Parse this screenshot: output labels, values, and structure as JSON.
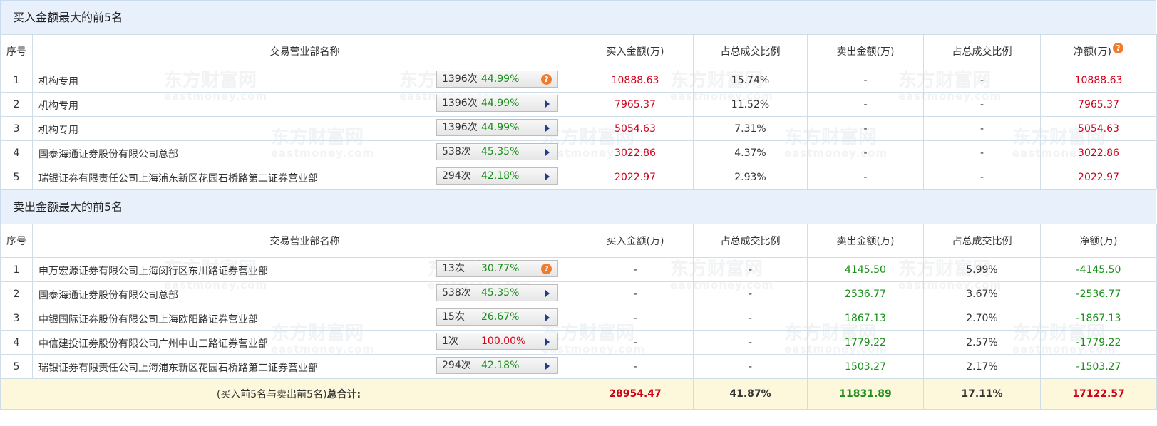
{
  "watermark": {
    "cn": "东方财富网",
    "en": "eastmoney.com"
  },
  "headers": {
    "no": "序号",
    "name": "交易营业部名称",
    "buy": "买入金额(万)",
    "buy_ratio": "占总成交比例",
    "sell": "卖出金额(万)",
    "sell_ratio": "占总成交比例",
    "net": "净额(万)"
  },
  "help_glyph": "?",
  "buy_section": {
    "title": "买入金额最大的前5名",
    "rows": [
      {
        "no": "1",
        "name": "机构专用",
        "count": "1396次",
        "pct": "44.99%",
        "pct_color": "green",
        "action": "help",
        "buy": "10888.63",
        "buy_ratio": "15.74%",
        "sell": "-",
        "sell_ratio": "-",
        "net": "10888.63"
      },
      {
        "no": "2",
        "name": "机构专用",
        "count": "1396次",
        "pct": "44.99%",
        "pct_color": "green",
        "action": "arrow",
        "buy": "7965.37",
        "buy_ratio": "11.52%",
        "sell": "-",
        "sell_ratio": "-",
        "net": "7965.37"
      },
      {
        "no": "3",
        "name": "机构专用",
        "count": "1396次",
        "pct": "44.99%",
        "pct_color": "green",
        "action": "arrow",
        "buy": "5054.63",
        "buy_ratio": "7.31%",
        "sell": "-",
        "sell_ratio": "-",
        "net": "5054.63"
      },
      {
        "no": "4",
        "name": "国泰海通证券股份有限公司总部",
        "count": "538次",
        "pct": "45.35%",
        "pct_color": "green",
        "action": "arrow",
        "buy": "3022.86",
        "buy_ratio": "4.37%",
        "sell": "-",
        "sell_ratio": "-",
        "net": "3022.86"
      },
      {
        "no": "5",
        "name": "瑞银证券有限责任公司上海浦东新区花园石桥路第二证券营业部",
        "count": "294次",
        "pct": "42.18%",
        "pct_color": "green",
        "action": "arrow",
        "buy": "2022.97",
        "buy_ratio": "2.93%",
        "sell": "-",
        "sell_ratio": "-",
        "net": "2022.97"
      }
    ]
  },
  "sell_section": {
    "title": "卖出金额最大的前5名",
    "rows": [
      {
        "no": "1",
        "name": "申万宏源证券有限公司上海闵行区东川路证券营业部",
        "count": "13次",
        "pct": "30.77%",
        "pct_color": "green",
        "action": "help",
        "buy": "-",
        "buy_ratio": "-",
        "sell": "4145.50",
        "sell_ratio": "5.99%",
        "net": "-4145.50"
      },
      {
        "no": "2",
        "name": "国泰海通证券股份有限公司总部",
        "count": "538次",
        "pct": "45.35%",
        "pct_color": "green",
        "action": "arrow",
        "buy": "-",
        "buy_ratio": "-",
        "sell": "2536.77",
        "sell_ratio": "3.67%",
        "net": "-2536.77"
      },
      {
        "no": "3",
        "name": "中银国际证券股份有限公司上海欧阳路证券营业部",
        "count": "15次",
        "pct": "26.67%",
        "pct_color": "green",
        "action": "arrow",
        "buy": "-",
        "buy_ratio": "-",
        "sell": "1867.13",
        "sell_ratio": "2.70%",
        "net": "-1867.13"
      },
      {
        "no": "4",
        "name": "中信建投证券股份有限公司广州中山三路证券营业部",
        "count": "1次",
        "pct": "100.00%",
        "pct_color": "red",
        "action": "arrow",
        "buy": "-",
        "buy_ratio": "-",
        "sell": "1779.22",
        "sell_ratio": "2.57%",
        "net": "-1779.22"
      },
      {
        "no": "5",
        "name": "瑞银证券有限责任公司上海浦东新区花园石桥路第二证券营业部",
        "count": "294次",
        "pct": "42.18%",
        "pct_color": "green",
        "action": "arrow",
        "buy": "-",
        "buy_ratio": "-",
        "sell": "1503.27",
        "sell_ratio": "2.17%",
        "net": "-1503.27"
      }
    ],
    "total": {
      "label_prefix": "(买入前5名与卖出前5名)",
      "label_bold": "总合计:",
      "buy": "28954.47",
      "buy_ratio": "41.87%",
      "sell": "11831.89",
      "sell_ratio": "17.11%",
      "net": "17122.57"
    }
  },
  "colors": {
    "buy": "#d0021b",
    "sell": "#1a8f1a",
    "header_bg": "#e8f1fb",
    "total_bg": "#fdf8dc"
  }
}
